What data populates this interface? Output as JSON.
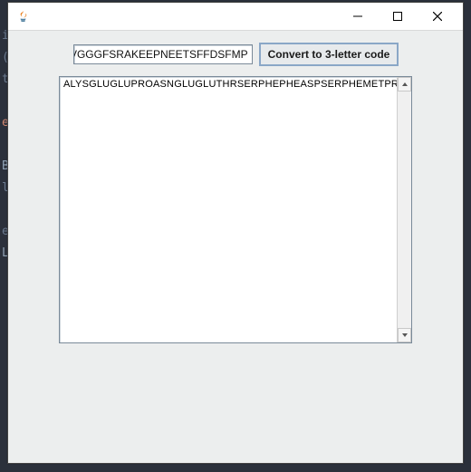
{
  "background_code": {
    "l1": "i",
    "l2": "(",
    "l3": "t",
    "l4": "",
    "l5_orange": "e",
    "l6": "",
    "l7_blue": "B",
    "l8": "l",
    "l9": "",
    "l10": "e",
    "l11_blue": "L"
  },
  "window": {
    "title": "",
    "controls": {
      "minimize": "minimize",
      "maximize": "maximize",
      "close": "close"
    }
  },
  "icon": {
    "java": "java-icon"
  },
  "toprow": {
    "input_value": "VGGGFSRAKEEPNEETSFFDSFMP",
    "button_label": "Convert to 3-letter code"
  },
  "result": {
    "text": "ALYSGLUGLUPROASNGLUGLUTHRSERPHEPHEASPSERPHEMETPRO"
  },
  "scrollbar": {
    "up": "scroll-up",
    "down": "scroll-down"
  }
}
